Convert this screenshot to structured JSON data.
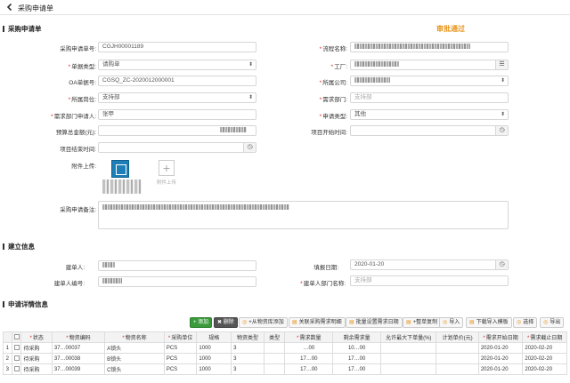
{
  "header": {
    "title": "采购申请单",
    "back_icon": "chevron-left-icon"
  },
  "form_section": {
    "title": "采购申请单",
    "status": "审批通过"
  },
  "form": {
    "order_no": {
      "label": "采购申请单号:",
      "value": "CGJH00001189"
    },
    "flow_name": {
      "label": "流程名称:"
    },
    "doc_type": {
      "label": "单据类型:",
      "value": "请购单"
    },
    "factory": {
      "label": "工厂:"
    },
    "oa_no": {
      "label": "OA单据号:",
      "value": "CGSQ_ZC-2020012000001"
    },
    "company": {
      "label": "所属公司:"
    },
    "position": {
      "label": "所属岗位:",
      "value": "支持部"
    },
    "req_dept": {
      "label": "需求部门:",
      "placeholder": "支持部"
    },
    "applicant": {
      "label": "需求部门申请人:",
      "value": "张甲"
    },
    "apply_type": {
      "label": "申请类型:",
      "value": "其他"
    },
    "budget": {
      "label": "预算总金额(元):"
    },
    "project_start": {
      "label": "项目开始时间:"
    },
    "project_end": {
      "label": "项目结束时间:"
    },
    "attachment": {
      "label": "附件上传:",
      "upload_text": "附件上传"
    },
    "remark": {
      "label": "采购申请备注:"
    }
  },
  "build_section": {
    "title": "建立信息"
  },
  "build": {
    "creator": {
      "label": "建单人:"
    },
    "fill_date": {
      "label": "填报日期:",
      "value": "2020-01-20"
    },
    "creator_no": {
      "label": "建单人编号:"
    },
    "creator_dept": {
      "label": "建单人部门名称:",
      "value": "支持部"
    }
  },
  "detail_section": {
    "title": "申请详情信息"
  },
  "toolbar": {
    "add": "+ 添加",
    "delete": "✖ 删除",
    "from_library": "+从物资库添加",
    "link_detail": "关联采购需求明细",
    "batch_date": "批量设置需求日期",
    "copy": "+整单复制",
    "import": "导入",
    "download_template": "下载导入模板",
    "select": "选择",
    "export": "导出"
  },
  "table": {
    "columns": [
      "",
      "",
      "状态",
      "物资编码",
      "物资名称",
      "采购单位",
      "规格",
      "物资类型",
      "类型",
      "需求数量",
      "剩余需求量",
      "允许最大下单量(%)",
      "计划单价(元)",
      "需求开始日期",
      "需求截止日期"
    ],
    "rows": [
      {
        "idx": "1",
        "status": "待采购",
        "code": "37…00037",
        "name": "A锁头",
        "unit": "PCS",
        "spec": "1000",
        "mtype": "3",
        "qty": "…00",
        "remain": "10…00",
        "start": "2020-01-20",
        "end": "2020-02-20"
      },
      {
        "idx": "2",
        "status": "待采购",
        "code": "37…00038",
        "name": "B锁头",
        "unit": "PCS",
        "spec": "1000",
        "mtype": "3",
        "qty": "17…00",
        "remain": "17…00",
        "start": "2020-01-20",
        "end": "2020-02-20"
      },
      {
        "idx": "3",
        "status": "待采购",
        "code": "37…00039",
        "name": "C锁头",
        "unit": "PCS",
        "spec": "1000",
        "mtype": "3",
        "qty": "17…00",
        "remain": "17…00",
        "start": "2020-01-20",
        "end": "2020-02-20"
      }
    ]
  },
  "colors": {
    "status_accent": "#e8941a",
    "add_button": "#3a9b3a",
    "delete_button": "#555555"
  }
}
